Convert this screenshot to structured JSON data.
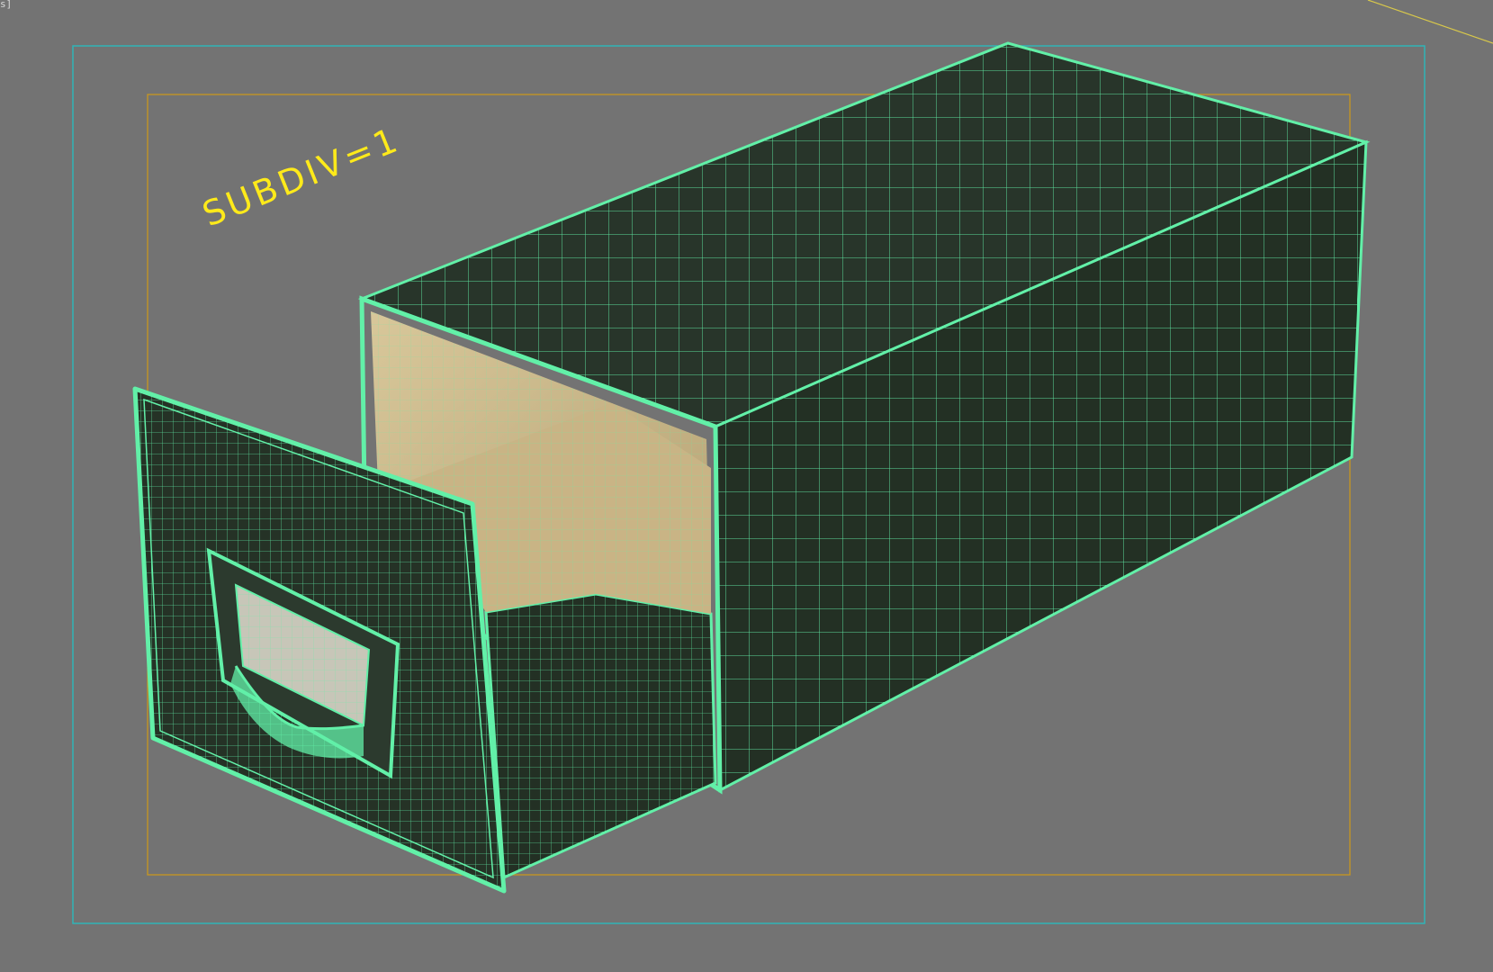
{
  "viewport": {
    "label_tail": "s]",
    "annotation": "SUBDIV=1",
    "colors": {
      "background": "#737373",
      "safe_frame_outer": "#2fb4b8",
      "safe_frame_inner": "#c8961e",
      "wireframe": "#62f0a8",
      "mesh_fill": "#253226",
      "interior_fill": "#cdb98a",
      "annotation": "#ffea1a",
      "axis_line": "#d8c84a"
    },
    "icons": [
      "drawer-handle-icon"
    ]
  }
}
